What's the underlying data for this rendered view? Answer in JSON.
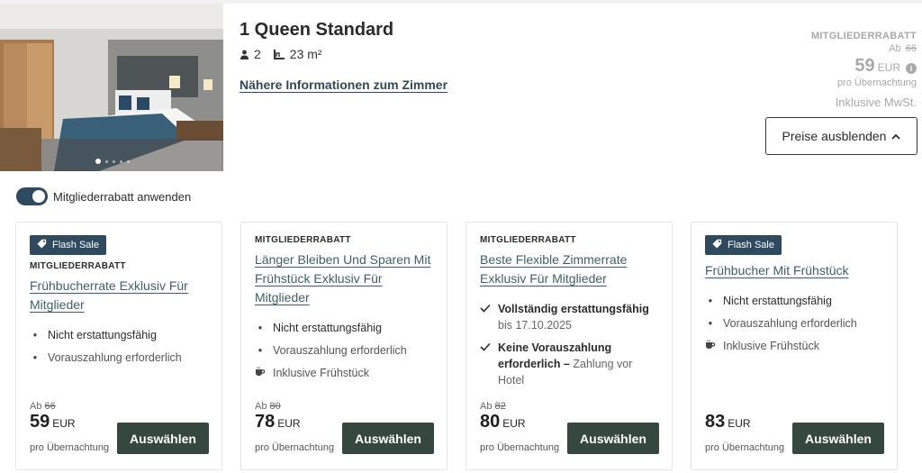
{
  "room": {
    "title": "1 Queen Standard",
    "guests": "2",
    "size": "23 m²",
    "details_link": "Nähere Informationen zum Zimmer",
    "image_slide_count": 5,
    "image_active_index": 0
  },
  "price_summary": {
    "label": "MITGLIEDERRABATT",
    "ab": "Ab",
    "old_price": "66",
    "price": "59",
    "currency": "EUR",
    "per_night": "pro Übernachtung",
    "vat": "Inklusive MwSt.",
    "hide_button": "Preise ausblenden"
  },
  "member_toggle": {
    "label": "Mitgliederrabatt anwenden",
    "on": true
  },
  "select_label": "Auswählen",
  "per_night_label": "pro Übernachtung",
  "currency": "EUR",
  "cards": [
    {
      "badge": "Flash Sale",
      "member": "MITGLIEDERRABATT",
      "title": "Frühbucherrate Exklusiv Für Mitglieder",
      "features": [
        {
          "icon": "bullet",
          "text": "Nicht erstattungsfähig"
        },
        {
          "icon": "bullet",
          "text": "Vorauszahlung erforderlich"
        }
      ],
      "ab": "Ab",
      "old_price": "66",
      "price": "59"
    },
    {
      "member": "MITGLIEDERRABATT",
      "title": "Länger Bleiben Und Sparen Mit Frühstück Exklusiv Für Mitglieder",
      "features": [
        {
          "icon": "bullet",
          "text": "Nicht erstattungsfähig"
        },
        {
          "icon": "bullet",
          "text": "Vorauszahlung erforderlich"
        },
        {
          "icon": "coffee",
          "text": "Inklusive Frühstück"
        }
      ],
      "ab": "Ab",
      "old_price": "80",
      "price": "78"
    },
    {
      "member": "MITGLIEDERRABATT",
      "title": "Beste Flexible Zimmerrate Exklusiv Für Mitglieder",
      "features": [
        {
          "icon": "check",
          "strong": "Vollständig erstattungsfähig",
          "sub": "bis 17.10.2025"
        },
        {
          "icon": "check",
          "strong": "Keine Vorauszahlung erforderlich –",
          "sub": "Zahlung vor Hotel"
        }
      ],
      "ab": "Ab",
      "old_price": "82",
      "price": "80"
    },
    {
      "badge": "Flash Sale",
      "title": "Frühbucher Mit Frühstück",
      "features": [
        {
          "icon": "bullet",
          "text": "Nicht erstattungsfähig"
        },
        {
          "icon": "bullet",
          "text": "Vorauszahlung erforderlich"
        },
        {
          "icon": "coffee",
          "text": "Inklusive Frühstück"
        }
      ],
      "price": "83"
    }
  ]
}
